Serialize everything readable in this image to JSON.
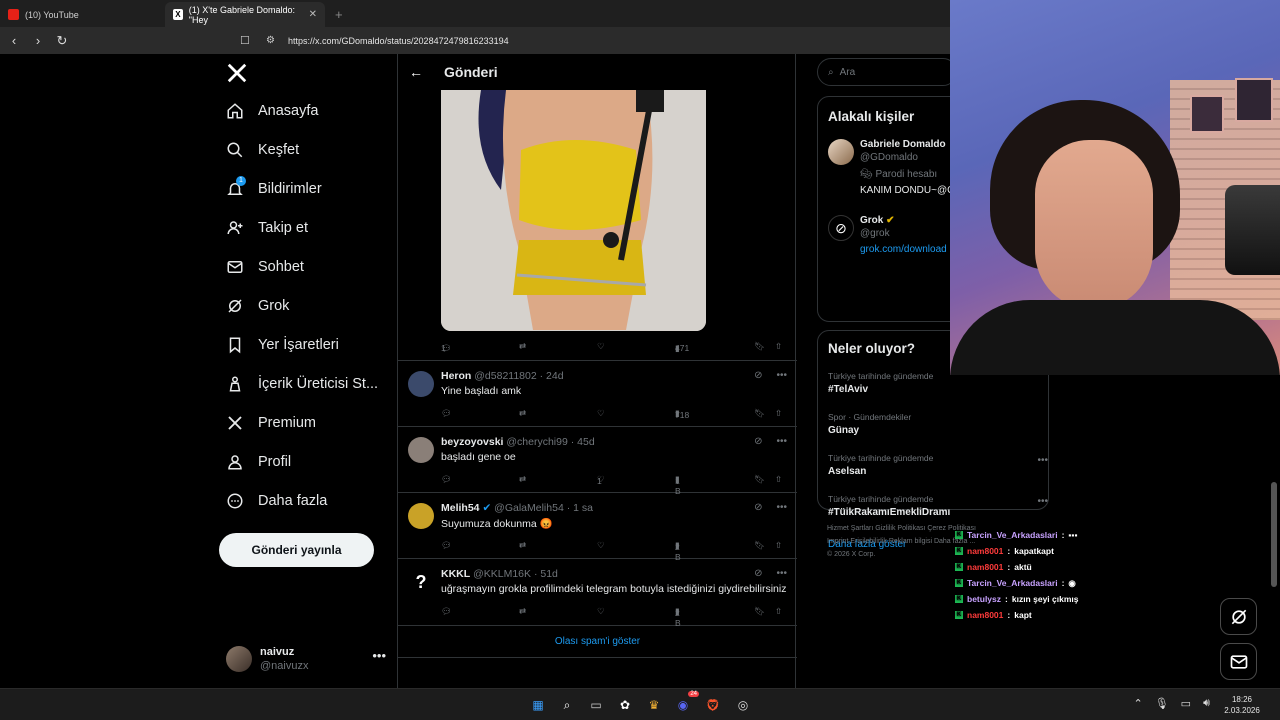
{
  "browser": {
    "tabs": [
      {
        "label": "(10) YouTube",
        "active": false,
        "icon": "youtube-icon"
      },
      {
        "label": "(1) X'te Gabriele Domaldo: \"Hey",
        "active": true,
        "icon": "x-logo-icon"
      }
    ],
    "url": "https://x.com/GDomaldo/status/2028472479816233194"
  },
  "sidebar": {
    "items": [
      {
        "label": "Anasayfa",
        "icon": "home-icon"
      },
      {
        "label": "Keşfet",
        "icon": "search-icon"
      },
      {
        "label": "Bildirimler",
        "icon": "bell-icon",
        "badge": "1"
      },
      {
        "label": "Takip et",
        "icon": "add-user-icon"
      },
      {
        "label": "Sohbet",
        "icon": "mail-icon"
      },
      {
        "label": "Grok",
        "icon": "grok-icon"
      },
      {
        "label": "Yer İşaretleri",
        "icon": "bookmark-icon"
      },
      {
        "label": "İçerik Üreticisi St...",
        "icon": "creator-studio-icon"
      },
      {
        "label": "Premium",
        "icon": "x-premium-icon"
      },
      {
        "label": "Profil",
        "icon": "profile-icon"
      },
      {
        "label": "Daha fazla",
        "icon": "more-circle-icon"
      }
    ],
    "post_button": "Gönderi yayınla",
    "account": {
      "name": "naivuz",
      "handle": "@naivuzx"
    }
  },
  "main": {
    "title": "Gönderi",
    "post_stats": {
      "replies": "1",
      "views": "471"
    },
    "replies": [
      {
        "name": "Heron",
        "handle": "@d58211802",
        "time": "24d",
        "text": "Yine başladı amk",
        "likes": "",
        "views": "718",
        "avatar_color": "#3b4a6b"
      },
      {
        "name": "beyzoyovski",
        "handle": "@cherychi99",
        "time": "45d",
        "text": "başladı gene oe",
        "likes": "1",
        "views": "1 B",
        "avatar_color": "#8a7f78"
      },
      {
        "name": "Melih54",
        "handle": "@GalaMelih54",
        "time": "1 sa",
        "text": "Suyumuza dokunma 😡",
        "likes": "",
        "views": "2 B",
        "avatar_color": "#c9a227",
        "verified": true
      },
      {
        "name": "KKKL",
        "handle": "@KKLM16K",
        "time": "51d",
        "text": "uğraşmayın grokla profilimdeki telegram botuyla istediğinizi giydirebilirsiniz",
        "likes": "",
        "views": "2 B",
        "avatar_color": "#000000"
      }
    ],
    "spam_link": "Olası spam'i göster"
  },
  "right": {
    "search_placeholder": "Ara",
    "related_title": "Alakalı kişiler",
    "people": [
      {
        "name": "Gabriele Domaldo",
        "handle": "@GDomaldo",
        "note": "Parodi hesabı",
        "bio": "KANIM DONDU~@G"
      },
      {
        "name": "Grok",
        "handle": "@grok",
        "link": "grok.com/download"
      }
    ],
    "trends_title": "Neler oluyor?",
    "trends": [
      {
        "meta": "Türkiye tarihinde gündemde",
        "title": "#TelAviv"
      },
      {
        "meta": "Spor · Gündemdekiler",
        "title": "Günay"
      },
      {
        "meta": "Türkiye tarihinde gündemde",
        "title": "Aselsan"
      },
      {
        "meta": "Türkiye tarihinde gündemde",
        "title": "#TüikRakamıEmekliDramı"
      }
    ],
    "show_more": "Daha fazla göster",
    "footer": {
      "line1": "Hizmet Şartları    Gizlilik Politikası    Çerez Politikası",
      "line2": "Imprint    Erişilebilirlik    Reklam bilgisi    Daha fazla ...",
      "line3": "© 2026 X Corp."
    }
  },
  "chat": [
    {
      "user": "Tarcin_Ve_Arkadaslari",
      "msg": "",
      "red": false
    },
    {
      "user": "nam8001",
      "msg": "kapatkapt",
      "red": true
    },
    {
      "user": "nam8001",
      "msg": "aktü",
      "red": true
    },
    {
      "user": "Tarcin_Ve_Arkadaslari",
      "msg": "",
      "red": false
    },
    {
      "user": "betulysz",
      "msg": "kızın şeyi çıkmış",
      "red": false
    },
    {
      "user": "nam8001",
      "msg": "kapt",
      "red": true
    }
  ],
  "taskbar": {
    "time": "18:26",
    "date": "2.03.2026",
    "discord_badge": "24"
  }
}
